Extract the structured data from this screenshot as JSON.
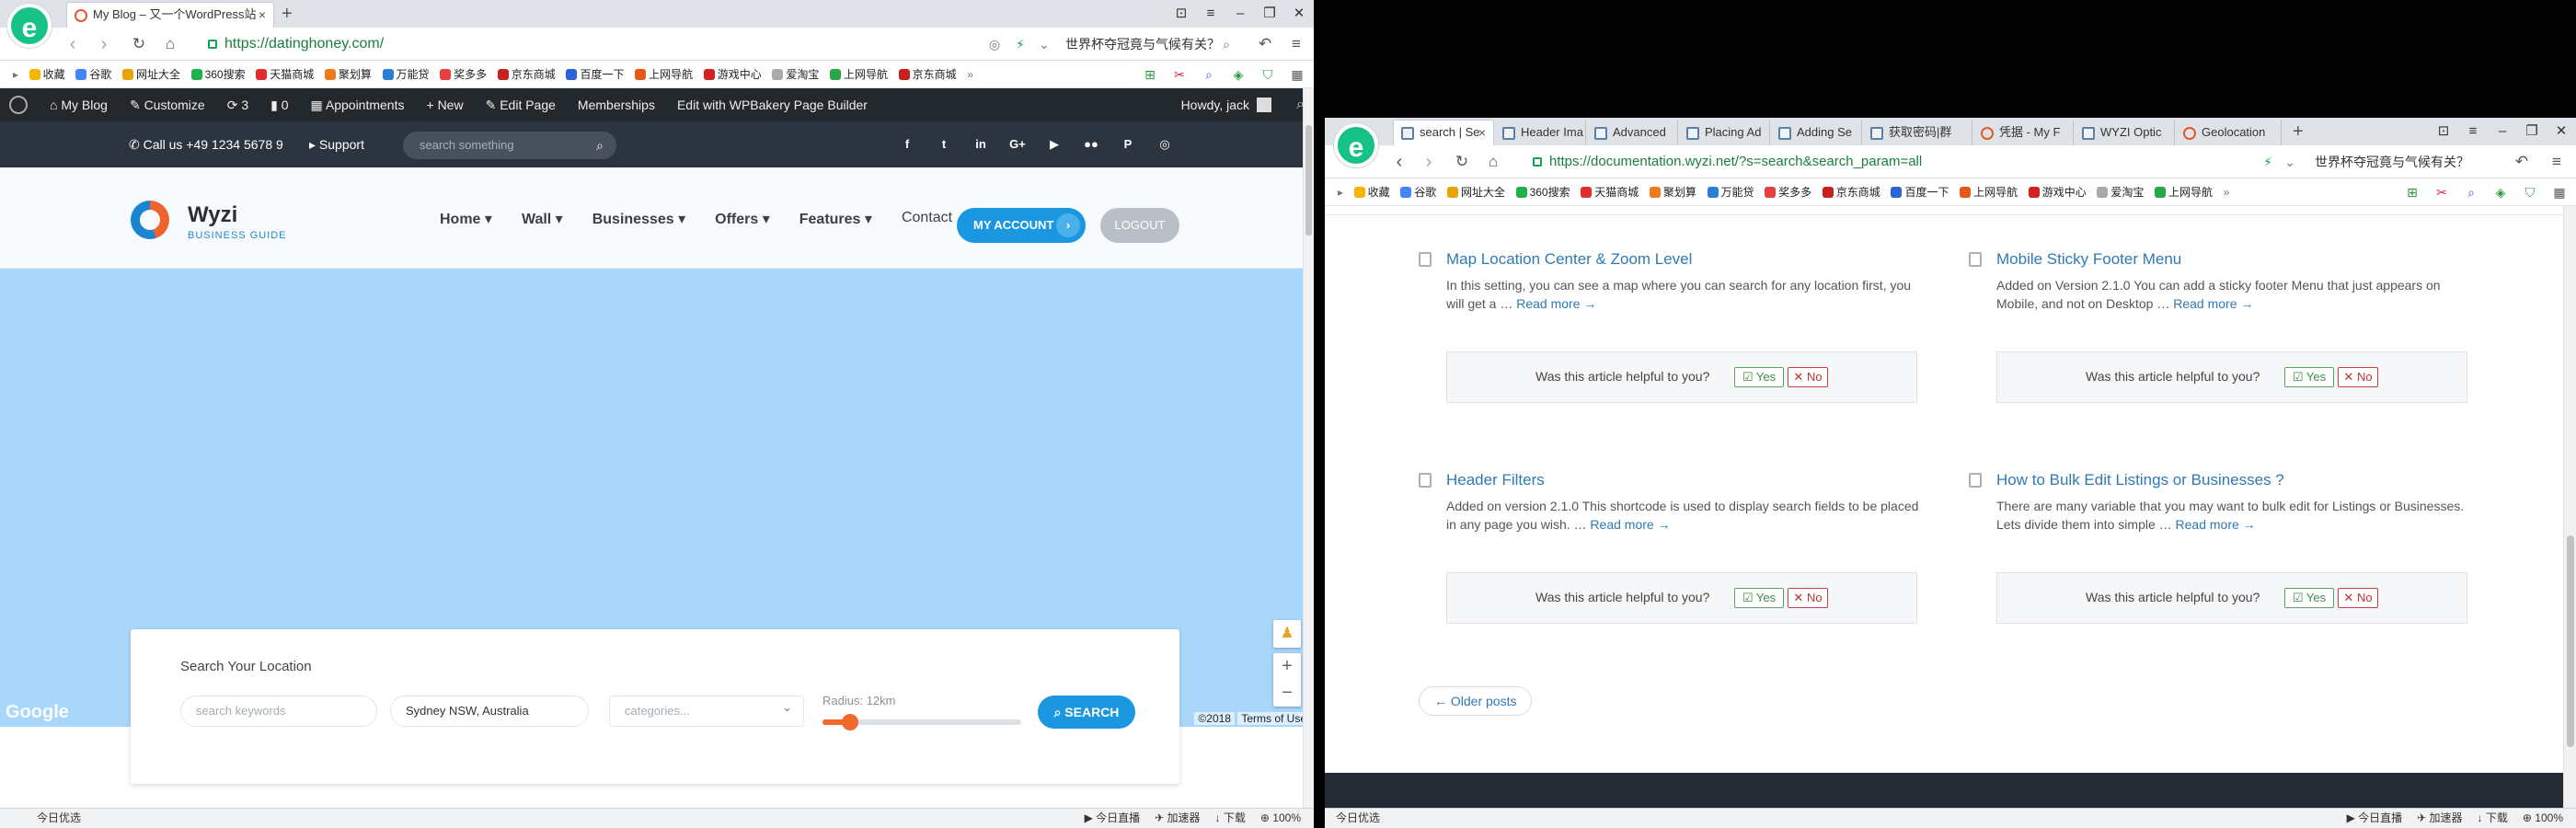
{
  "left": {
    "tab_title": "My Blog – 又一个WordPress站",
    "url": "https://datinghoney.com/",
    "search_text": "世界杯夺冠竟与气候有关？",
    "bookmarks": [
      "收藏",
      "谷歌",
      "网址大全",
      "360搜索",
      "天猫商城",
      "聚划算",
      "万能贷",
      "奖多多",
      "京东商城",
      "百度一下",
      "上网导航",
      "游戏中心",
      "爱淘宝",
      "上网导航",
      "京东商城"
    ],
    "bookmarks_more": "»",
    "wp_admin": {
      "my_blog": "My Blog",
      "customize": "Customize",
      "updates": "3",
      "comments": "0",
      "appointments": "Appointments",
      "new": "New",
      "edit_page": "Edit Page",
      "memberships": "Memberships",
      "wpbakery": "Edit with WPBakery Page Builder",
      "howdy": "Howdy, jack"
    },
    "topbar": {
      "phone": "Call us +49 1234 5678 9",
      "support": "Support",
      "search_placeholder": "search something"
    },
    "brand": {
      "name": "Wyzi",
      "tagline": "BUSINESS GUIDE"
    },
    "nav": [
      "Home",
      "Wall",
      "Businesses",
      "Offers",
      "Features",
      "Contact"
    ],
    "my_account": "MY ACCOUNT",
    "logout": "LOGOUT",
    "map": {
      "google": "Google",
      "copyright": "©2018",
      "terms": "Terms of Use"
    },
    "search_panel": {
      "title": "Search Your Location",
      "keywords_placeholder": "search keywords",
      "location_value": "Sydney NSW, Australia",
      "categories_placeholder": "categories...",
      "radius_label": "Radius: 12km",
      "radius_fraction": 0.14,
      "search_button": "SEARCH"
    },
    "status": {
      "left": "今日优选",
      "live": "今日直播",
      "accel": "加速器",
      "download": "下载",
      "zoom": "100%"
    }
  },
  "right": {
    "tabs": [
      "search | Se",
      "Header Ima",
      "Advanced",
      "Placing Ad",
      "Adding Se",
      "获取密码|群",
      "凭据 - My F",
      "WYZI Optic",
      "Geolocation"
    ],
    "url": "https://documentation.wyzi.net/?s=search&search_param=all",
    "search_text": "世界杯夺冠竟与气候有关？",
    "bookmarks": [
      "收藏",
      "谷歌",
      "网址大全",
      "360搜索",
      "天猫商城",
      "聚划算",
      "万能贷",
      "奖多多",
      "京东商城",
      "百度一下",
      "上网导航",
      "游戏中心",
      "爱淘宝",
      "上网导航"
    ],
    "bookmarks_more": "»",
    "articles": [
      {
        "title": "Map Location Center & Zoom Level",
        "excerpt": "In this setting, you can see a map where you can search for any location first, you will get a …",
        "read_more": "Read more →"
      },
      {
        "title": "Mobile Sticky Footer Menu",
        "excerpt": "Added on Version 2.1.0 You can add a sticky footer Menu that just appears on Mobile, and not on Desktop …",
        "read_more": "Read more →"
      },
      {
        "title": "Header Filters",
        "excerpt": "Added on version 2.1.0 This shortcode is used to display search fields to be placed in any page you wish. …",
        "read_more": "Read more →"
      },
      {
        "title": "How to Bulk Edit Listings or Businesses ?",
        "excerpt": "There are many variable that you may want to bulk edit for Listings or Businesses. Lets divide them into simple …",
        "read_more": "Read more →"
      }
    ],
    "helpful": {
      "question": "Was this article helpful to you?",
      "yes": "Yes",
      "no": "No"
    },
    "older_posts": "← Older posts",
    "status": {
      "left": "今日优选",
      "live": "今日直播",
      "accel": "加速器",
      "download": "下载",
      "zoom": "100%"
    }
  },
  "colors": {
    "brand_blue": "#1a97e0",
    "accent_orange": "#ef6b2b",
    "wp_bar": "#23282d",
    "map_water": "#a9d7fb",
    "link_blue": "#2f79b5"
  }
}
